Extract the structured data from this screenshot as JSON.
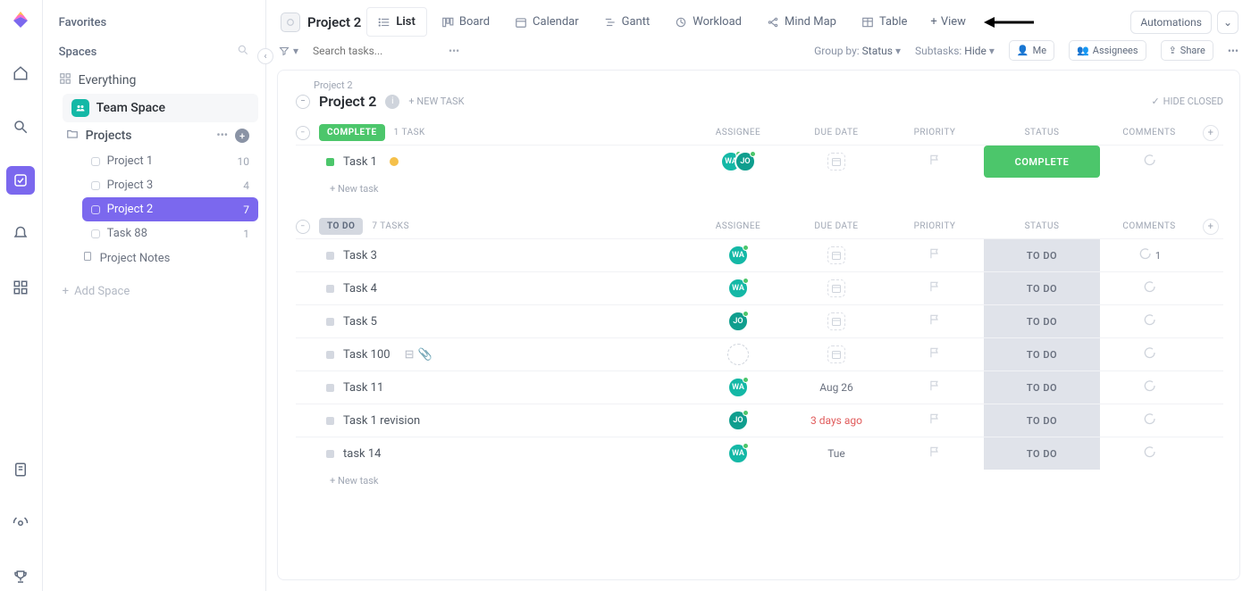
{
  "sidebar": {
    "favorites": "Favorites",
    "spaces": "Spaces",
    "everything": "Everything",
    "team_space": "Team Space",
    "projects_label": "Projects",
    "items": [
      {
        "label": "Project 1",
        "count": "10"
      },
      {
        "label": "Project 3",
        "count": "4"
      },
      {
        "label": "Project 2",
        "count": "7"
      },
      {
        "label": "Task 88",
        "count": "1"
      }
    ],
    "project_notes": "Project Notes",
    "add_space": "Add Space"
  },
  "header": {
    "crumb_title": "Project 2",
    "automations": "Automations",
    "tabs": {
      "list": "List",
      "board": "Board",
      "calendar": "Calendar",
      "gantt": "Gantt",
      "workload": "Workload",
      "mindmap": "Mind Map",
      "table": "Table",
      "addview": "View"
    }
  },
  "toolbar": {
    "search_placeholder": "Search tasks...",
    "group_by_label": "Group by:",
    "group_by_value": "Status",
    "subtasks_label": "Subtasks:",
    "subtasks_value": "Hide",
    "me": "Me",
    "assignees": "Assignees",
    "share": "Share"
  },
  "list_header": {
    "breadcrumb": "Project 2",
    "title": "Project 2",
    "new_task": "+ NEW TASK",
    "hide_closed": "HIDE CLOSED"
  },
  "columns": {
    "assignee": "ASSIGNEE",
    "due": "DUE DATE",
    "priority": "PRIORITY",
    "status": "STATUS",
    "comments": "COMMENTS"
  },
  "groups": [
    {
      "status_label": "COMPLETE",
      "status_class": "complete",
      "count_label": "1 TASK",
      "big_status_class": "big-complete",
      "tasks": [
        {
          "name": "Task 1",
          "sq": "green",
          "avatars": [
            {
              "txt": "WA",
              "cls": "teal",
              "on": true
            },
            {
              "txt": "JO",
              "cls": "green2",
              "on": true
            }
          ],
          "due": "",
          "due_cls": "",
          "status": "COMPLETE",
          "comments": "",
          "yellow": true
        }
      ]
    },
    {
      "status_label": "TO DO",
      "status_class": "todo",
      "count_label": "7 TASKS",
      "big_status_class": "big-todo",
      "tasks": [
        {
          "name": "Task 3",
          "sq": "grey",
          "avatars": [
            {
              "txt": "WA",
              "cls": "teal",
              "on": true
            }
          ],
          "due": "",
          "due_cls": "",
          "status": "TO DO",
          "comments": "1"
        },
        {
          "name": "Task 4",
          "sq": "grey",
          "avatars": [
            {
              "txt": "WA",
              "cls": "teal",
              "on": true
            }
          ],
          "due": "",
          "due_cls": "",
          "status": "TO DO",
          "comments": ""
        },
        {
          "name": "Task 5",
          "sq": "grey",
          "avatars": [
            {
              "txt": "JO",
              "cls": "green2",
              "on": true
            }
          ],
          "due": "",
          "due_cls": "",
          "status": "TO DO",
          "comments": ""
        },
        {
          "name": "Task 100",
          "sq": "grey",
          "avatars": [
            {
              "txt": "",
              "cls": "empty",
              "on": false
            }
          ],
          "due": "",
          "due_cls": "",
          "status": "TO DO",
          "comments": "",
          "extras": true
        },
        {
          "name": "Task 11",
          "sq": "grey",
          "avatars": [
            {
              "txt": "WA",
              "cls": "teal",
              "on": true
            }
          ],
          "due": "Aug 26",
          "due_cls": "",
          "status": "TO DO",
          "comments": ""
        },
        {
          "name": "Task 1 revision",
          "sq": "grey",
          "avatars": [
            {
              "txt": "JO",
              "cls": "green2",
              "on": true
            }
          ],
          "due": "3 days ago",
          "due_cls": "overdue",
          "status": "TO DO",
          "comments": ""
        },
        {
          "name": "task 14",
          "sq": "grey",
          "avatars": [
            {
              "txt": "WA",
              "cls": "teal",
              "on": true
            }
          ],
          "due": "Tue",
          "due_cls": "",
          "status": "TO DO",
          "comments": ""
        }
      ]
    }
  ],
  "new_task_row": "+ New task"
}
